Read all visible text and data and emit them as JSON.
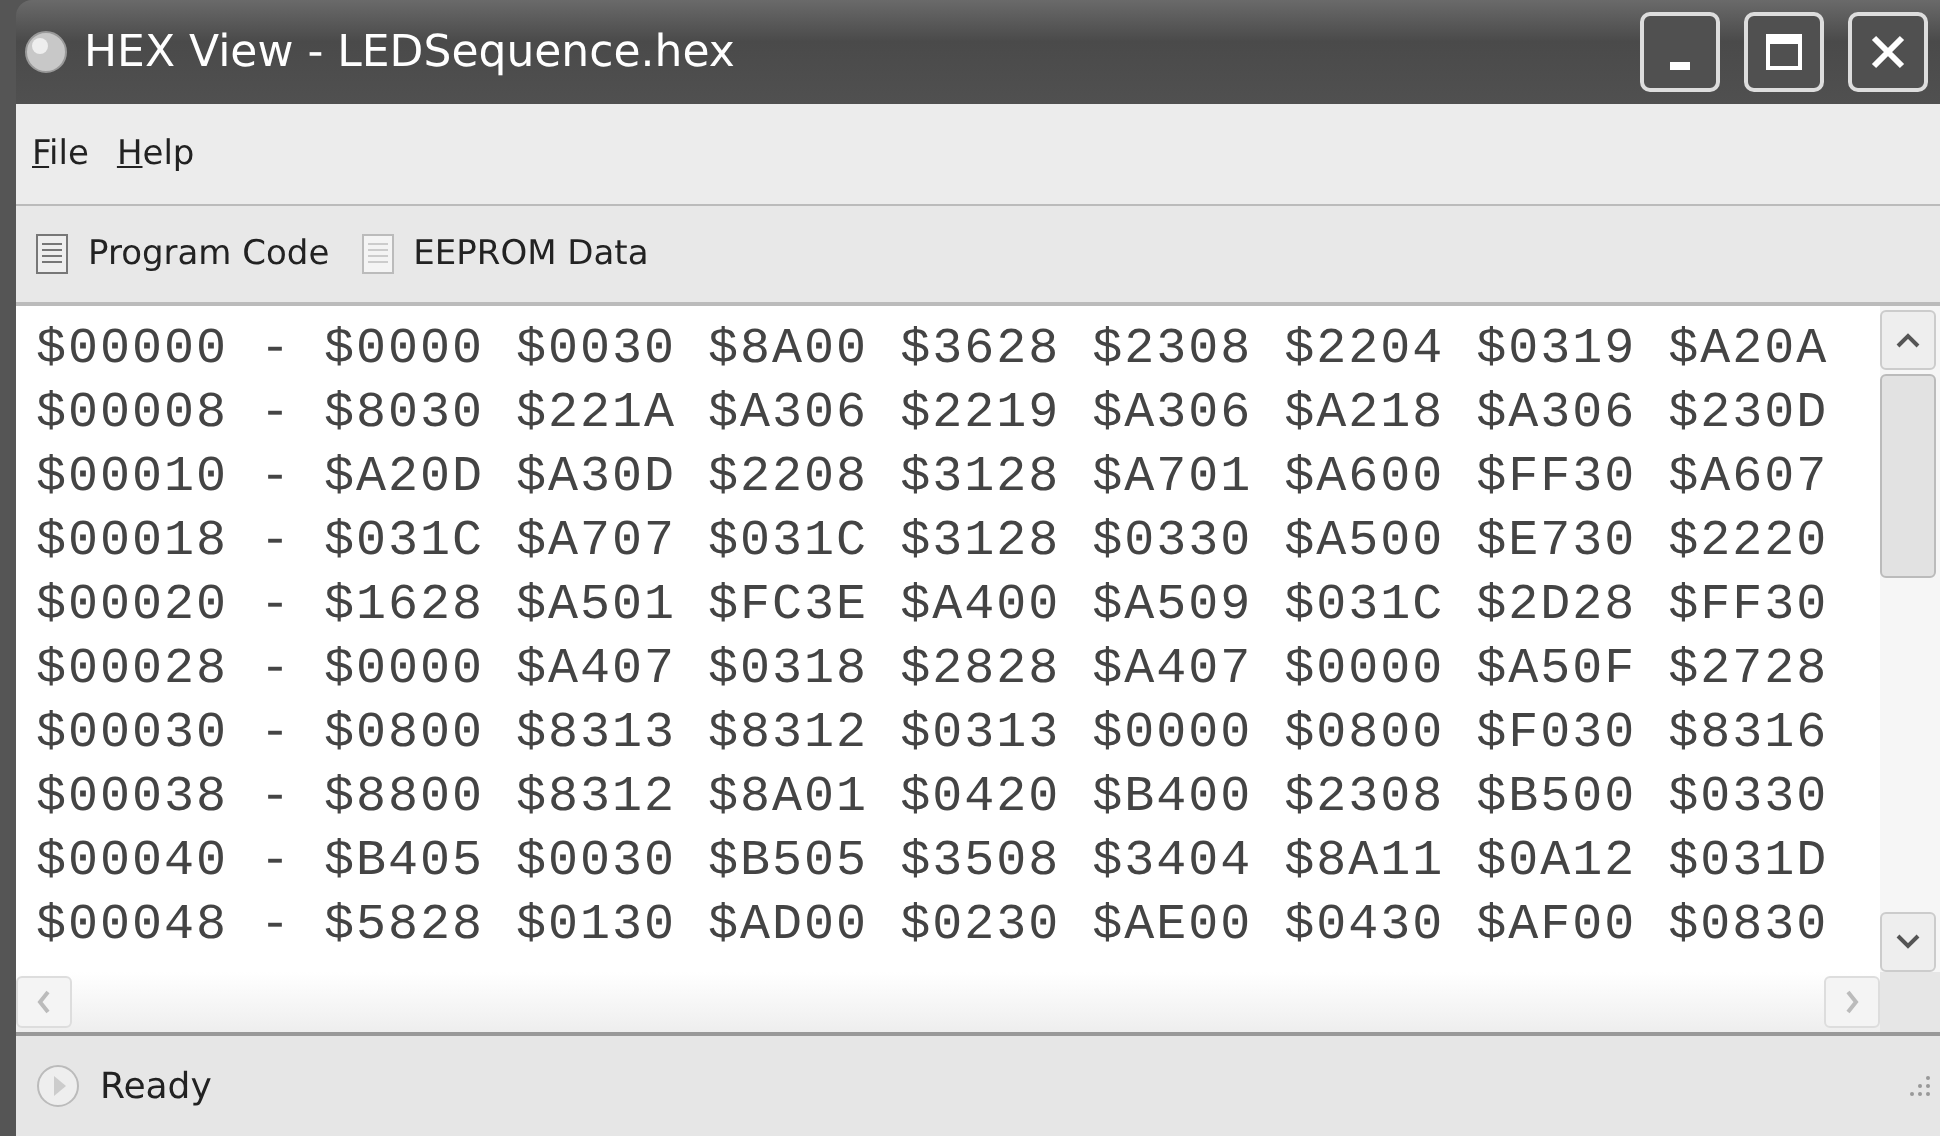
{
  "window": {
    "title": "HEX View - LEDSequence.hex"
  },
  "menu": [
    {
      "label": "File"
    },
    {
      "label": "Help"
    }
  ],
  "toolbar": [
    {
      "label": "Program Code",
      "disabled": false
    },
    {
      "label": "EEPROM Data",
      "disabled": true
    }
  ],
  "hex_lines": [
    "$00000 - $0000 $0030 $8A00 $3628 $2308 $2204 $0319 $A20A",
    "$00008 - $8030 $221A $A306 $2219 $A306 $A218 $A306 $230D",
    "$00010 - $A20D $A30D $2208 $3128 $A701 $A600 $FF30 $A607",
    "$00018 - $031C $A707 $031C $3128 $0330 $A500 $E730 $2220",
    "$00020 - $1628 $A501 $FC3E $A400 $A509 $031C $2D28 $FF30",
    "$00028 - $0000 $A407 $0318 $2828 $A407 $0000 $A50F $2728",
    "$00030 - $0800 $8313 $8312 $0313 $0000 $0800 $F030 $8316",
    "$00038 - $8800 $8312 $8A01 $0420 $B400 $2308 $B500 $0330",
    "$00040 - $B405 $0030 $B505 $3508 $3404 $8A11 $0A12 $031D",
    "$00048 - $5828 $0130 $AD00 $0230 $AE00 $0430 $AF00 $0830"
  ],
  "status_bar": {
    "text": "Ready"
  }
}
